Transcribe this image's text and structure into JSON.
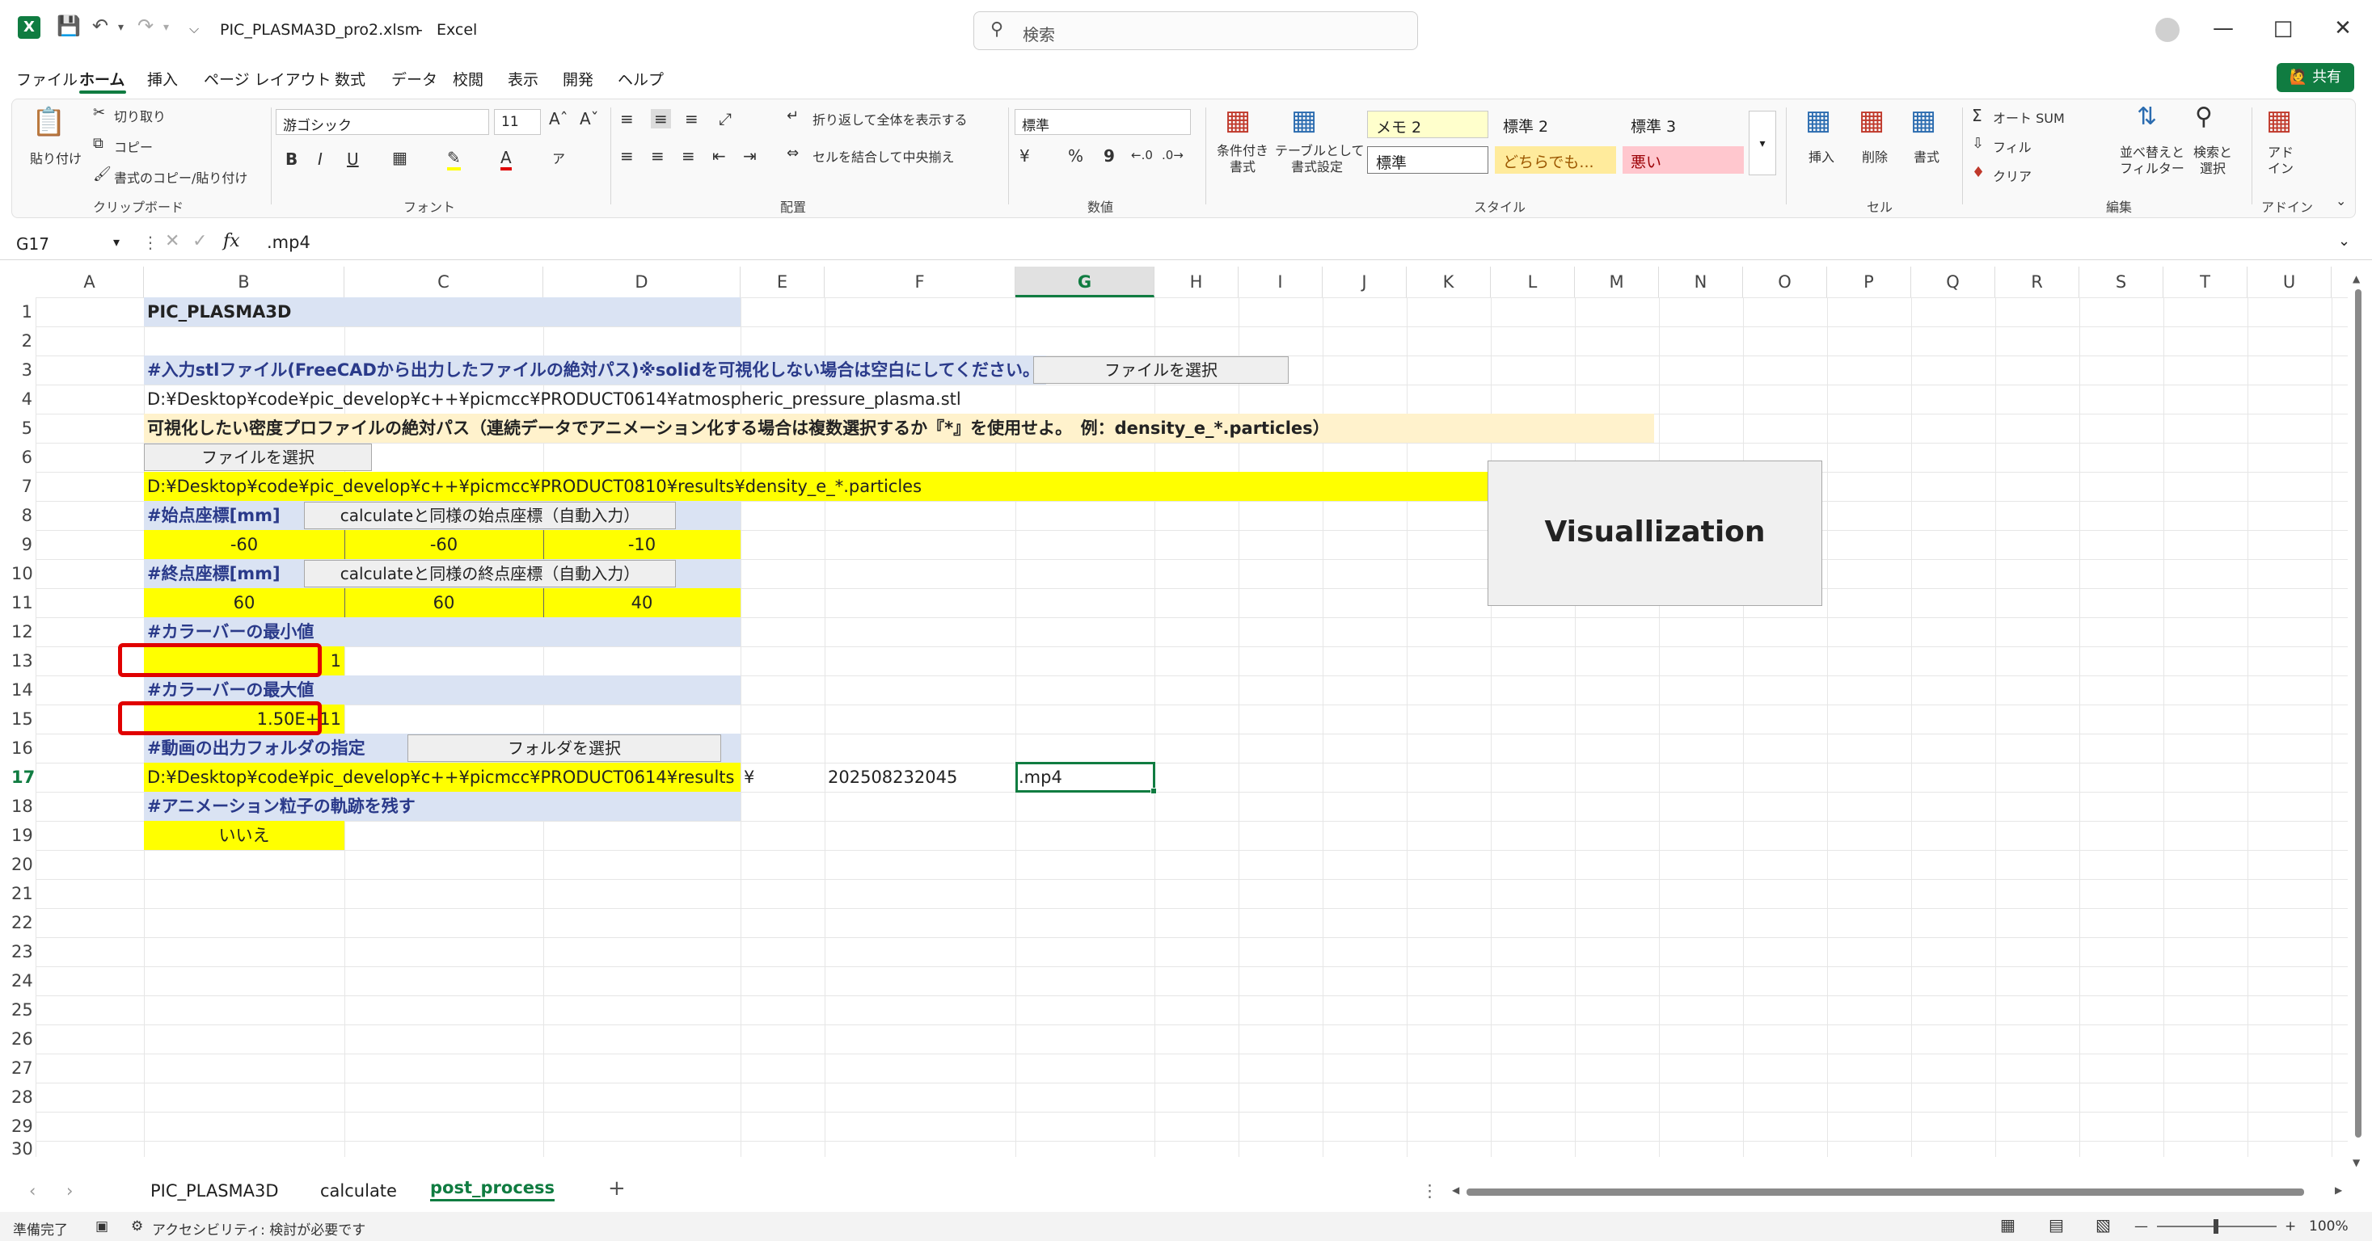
{
  "window": {
    "file_name": "PIC_PLASMA3D_pro2.xlsm",
    "dash": "-",
    "app": "Excel",
    "search_placeholder": "検索"
  },
  "menu": {
    "tabs": [
      "ファイル",
      "ホーム",
      "挿入",
      "ページ レイアウト",
      "数式",
      "データ",
      "校閲",
      "表示",
      "開発",
      "ヘルプ"
    ],
    "share": "共有"
  },
  "ribbon": {
    "clipboard": {
      "paste": "貼り付け",
      "cut": "切り取り",
      "copy": "コピー",
      "format_painter": "書式のコピー/貼り付け",
      "group": "クリップボード"
    },
    "font": {
      "name": "游ゴシック",
      "size": "11",
      "bold": "B",
      "italic": "I",
      "underline": "U",
      "group": "フォント"
    },
    "alignment": {
      "wrap": "折り返して全体を表示する",
      "merge": "セルを結合して中央揃え",
      "group": "配置"
    },
    "number": {
      "format": "標準",
      "percent": "%",
      "comma": "9",
      "group": "数値"
    },
    "styles": {
      "conditional": "条件付き\n書式",
      "table": "テーブルとして\n書式設定",
      "cells": [
        "メモ 2",
        "標準 2",
        "標準 3",
        "標準",
        "どちらでも...",
        "悪い"
      ],
      "group": "スタイル"
    },
    "cells_group": {
      "insert": "挿入",
      "delete": "削除",
      "format": "書式",
      "group": "セル"
    },
    "editing": {
      "autosum": "オート SUM",
      "fill": "フィル",
      "clear": "クリア",
      "sort": "並べ替えと\nフィルター",
      "find": "検索と\n選択",
      "group": "編集"
    },
    "addins": {
      "label": "アド\nイン",
      "group": "アドイン"
    }
  },
  "formula_bar": {
    "name_box": "G17",
    "fx": "fx",
    "content": ".mp4"
  },
  "columns": [
    "A",
    "B",
    "C",
    "D",
    "E",
    "F",
    "G",
    "H",
    "I",
    "J",
    "K",
    "L",
    "M",
    "N",
    "O",
    "P",
    "Q",
    "R",
    "S",
    "T",
    "U"
  ],
  "rows": [
    "1",
    "2",
    "3",
    "4",
    "5",
    "6",
    "7",
    "8",
    "9",
    "10",
    "11",
    "12",
    "13",
    "14",
    "15",
    "16",
    "17",
    "18",
    "19",
    "20",
    "21",
    "22",
    "23",
    "24",
    "25",
    "26",
    "27",
    "28",
    "29",
    "30"
  ],
  "sheet": {
    "b1": "PIC_PLASMA3D",
    "b3": "#入力stlファイル(FreeCADから出力したファイルの絶対パス)※solidを可視化しない場合は空白にしてください。",
    "btn_file_select_1": "ファイルを選択",
    "b4": "D:¥Desktop¥code¥pic_develop¥c++¥picmcc¥PRODUCT0614¥atmospheric_pressure_plasma.stl",
    "b5": "可視化したい密度プロファイルの絶対パス（連続データでアニメーション化する場合は複数選択するか『*』を使用せよ。　例：density_e_*.particles）",
    "btn_file_select_2": "ファイルを選択",
    "b7": "D:¥Desktop¥code¥pic_develop¥c++¥picmcc¥PRODUCT0810¥results¥density_e_*.particles",
    "b8": "#始点座標[mm]",
    "btn_start": "calculateと同様の始点座標（自動入力）",
    "b9": "-60",
    "c9": "-60",
    "d9": "-10",
    "b10": "#終点座標[mm]",
    "btn_end": "calculateと同様の終点座標（自動入力）",
    "b11": "60",
    "c11": "60",
    "d11": "40",
    "b12": "#カラーバーの最小値",
    "b13": "1",
    "b14": "#カラーバーの最大値",
    "b15": "1.50E+11",
    "b16": "#動画の出力フォルダの指定",
    "btn_folder": "フォルダを選択",
    "b17": "D:¥Desktop¥code¥pic_develop¥c++¥picmcc¥PRODUCT0614¥results",
    "e17": "¥",
    "f17": "202508232045",
    "g17": ".mp4",
    "b18": "#アニメーション粒子の軌跡を残す",
    "b19": "いいえ",
    "btn_visualization": "Visuallization"
  },
  "sheet_tabs": [
    "PIC_PLASMA3D",
    "calculate",
    "post_process"
  ],
  "status": {
    "ready": "準備完了",
    "accessibility": "アクセシビリティ: 検討が必要です",
    "zoom": "100%"
  },
  "colors": {
    "excel_green": "#107c41",
    "yellow": "#ffff00",
    "header_blue": "#dae3f3",
    "note_yellow": "#fff2cc",
    "red_border": "#e00000"
  }
}
